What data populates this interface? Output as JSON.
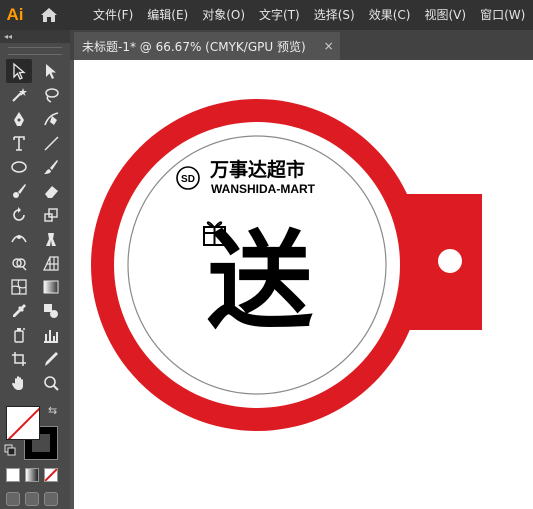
{
  "app": {
    "logo_text": "Ai",
    "accent_color": "#ff9a00"
  },
  "menu": {
    "items": [
      "文件(F)",
      "编辑(E)",
      "对象(O)",
      "文字(T)",
      "选择(S)",
      "效果(C)",
      "视图(V)",
      "窗口(W)"
    ]
  },
  "document": {
    "tab_title": "未标题-1* @ 66.67% (CMYK/GPU 预览)",
    "close_glyph": "×"
  },
  "toolbar": {
    "collapse_glyph": "◂◂",
    "swap_glyph": "⇆",
    "tools": [
      [
        "selection-tool",
        "direct-selection-tool"
      ],
      [
        "magic-wand-tool",
        "lasso-tool"
      ],
      [
        "pen-tool",
        "curvature-tool"
      ],
      [
        "type-tool",
        "line-segment-tool"
      ],
      [
        "ellipse-tool",
        "paintbrush-tool"
      ],
      [
        "blob-brush-tool",
        "eraser-tool"
      ],
      [
        "rotate-tool",
        "scale-tool"
      ],
      [
        "width-tool",
        "puppet-warp-tool"
      ],
      [
        "shape-builder-tool",
        "perspective-grid-tool"
      ],
      [
        "mesh-tool",
        "gradient-tool"
      ],
      [
        "eyedropper-tool",
        "blend-tool"
      ],
      [
        "symbol-sprayer-tool",
        "column-graph-tool"
      ],
      [
        "artboard-tool",
        "slice-tool"
      ],
      [
        "hand-tool",
        "zoom-tool"
      ]
    ]
  },
  "artwork": {
    "brand_cn": "万事达超市",
    "brand_en": "WANSHIDA-MART",
    "logo_mark": "SD",
    "main_char": "送",
    "colors": {
      "ring": "#dc1c22",
      "inner_circle_stroke": "#8a8a8a",
      "text": "#000000",
      "background": "#ffffff"
    }
  }
}
